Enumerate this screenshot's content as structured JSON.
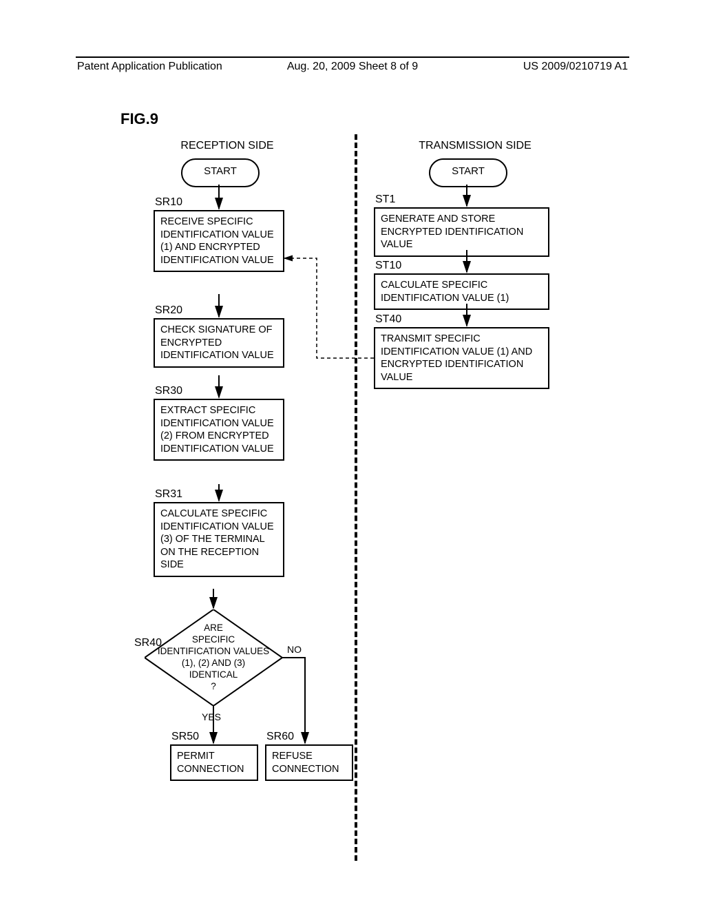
{
  "header": {
    "left": "Patent Application Publication",
    "center": "Aug. 20, 2009  Sheet 8 of 9",
    "right": "US 2009/0210719 A1"
  },
  "figure_title": "FIG.9",
  "reception": {
    "title": "RECEPTION SIDE",
    "start": "START",
    "sr10_label": "SR10",
    "sr10": "RECEIVE SPECIFIC IDENTIFICATION VALUE (1) AND ENCRYPTED IDENTIFICATION VALUE",
    "sr20_label": "SR20",
    "sr20": "CHECK SIGNATURE OF ENCRYPTED IDENTIFICATION VALUE",
    "sr30_label": "SR30",
    "sr30": "EXTRACT SPECIFIC IDENTIFICATION VALUE (2) FROM ENCRYPTED IDENTIFICATION VALUE",
    "sr31_label": "SR31",
    "sr31": "CALCULATE SPECIFIC IDENTIFICATION VALUE (3) OF THE TERMINAL ON THE RECEPTION SIDE",
    "sr40_label": "SR40",
    "sr40": "ARE\nSPECIFIC\nIDENTIFICATION VALUES\n(1), (2) AND (3)\nIDENTICAL\n?",
    "yes": "YES",
    "no": "NO",
    "sr50_label": "SR50",
    "sr50": "PERMIT CONNECTION",
    "sr60_label": "SR60",
    "sr60": "REFUSE CONNECTION"
  },
  "transmission": {
    "title": "TRANSMISSION SIDE",
    "start": "START",
    "st1_label": "ST1",
    "st1": "GENERATE AND STORE ENCRYPTED IDENTIFICATION VALUE",
    "st10_label": "ST10",
    "st10": "CALCULATE SPECIFIC IDENTIFICATION VALUE (1)",
    "st40_label": "ST40",
    "st40": "TRANSMIT SPECIFIC IDENTIFICATION VALUE (1) AND ENCRYPTED IDENTIFICATION VALUE"
  }
}
